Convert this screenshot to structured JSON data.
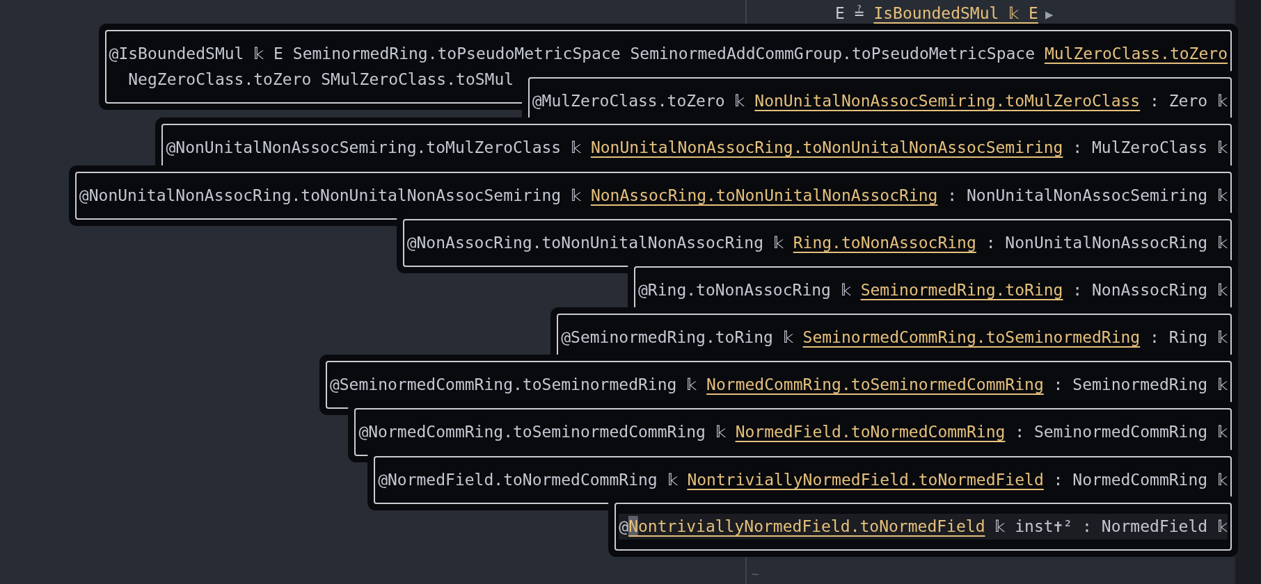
{
  "goal": {
    "before": "E ≟ ",
    "link": "IsBoundedSMul 𝕜 E",
    "toggle": "▶"
  },
  "popups": [
    {
      "lines": [
        [
          {
            "kind": "text",
            "text": "@IsBoundedSMul 𝕜 E SeminormedRing.toPseudoMetricSpace SeminormedAddCommGroup.toPseudoMetricSpace "
          },
          {
            "kind": "link",
            "text": "MulZeroClass.toZero"
          }
        ],
        [
          {
            "kind": "text",
            "text": "  NegZeroClass.toZero SMulZeroClass.toSMul"
          }
        ]
      ]
    },
    {
      "lines": [
        [
          {
            "kind": "text",
            "text": "@MulZeroClass.toZero 𝕜 "
          },
          {
            "kind": "link",
            "text": "NonUnitalNonAssocSemiring.toMulZeroClass"
          },
          {
            "kind": "text",
            "text": " : Zero 𝕜"
          }
        ]
      ]
    },
    {
      "lines": [
        [
          {
            "kind": "text",
            "text": "@NonUnitalNonAssocSemiring.toMulZeroClass 𝕜 "
          },
          {
            "kind": "link",
            "text": "NonUnitalNonAssocRing.toNonUnitalNonAssocSemiring"
          },
          {
            "kind": "text",
            "text": " : MulZeroClass 𝕜"
          }
        ]
      ]
    },
    {
      "lines": [
        [
          {
            "kind": "text",
            "text": "@NonUnitalNonAssocRing.toNonUnitalNonAssocSemiring 𝕜 "
          },
          {
            "kind": "link",
            "text": "NonAssocRing.toNonUnitalNonAssocRing"
          },
          {
            "kind": "text",
            "text": " : NonUnitalNonAssocSemiring 𝕜"
          }
        ]
      ]
    },
    {
      "lines": [
        [
          {
            "kind": "text",
            "text": "@NonAssocRing.toNonUnitalNonAssocRing 𝕜 "
          },
          {
            "kind": "link",
            "text": "Ring.toNonAssocRing"
          },
          {
            "kind": "text",
            "text": " : NonUnitalNonAssocRing 𝕜"
          }
        ]
      ]
    },
    {
      "lines": [
        [
          {
            "kind": "text",
            "text": "@Ring.toNonAssocRing 𝕜 "
          },
          {
            "kind": "link",
            "text": "SeminormedRing.toRing"
          },
          {
            "kind": "text",
            "text": " : NonAssocRing 𝕜"
          }
        ]
      ]
    },
    {
      "lines": [
        [
          {
            "kind": "text",
            "text": "@SeminormedRing.toRing 𝕜 "
          },
          {
            "kind": "link",
            "text": "SeminormedCommRing.toSeminormedRing"
          },
          {
            "kind": "text",
            "text": " : Ring 𝕜"
          }
        ]
      ]
    },
    {
      "lines": [
        [
          {
            "kind": "text",
            "text": "@SeminormedCommRing.toSeminormedRing 𝕜 "
          },
          {
            "kind": "link",
            "text": "NormedCommRing.toSeminormedCommRing"
          },
          {
            "kind": "text",
            "text": " : SeminormedRing 𝕜"
          }
        ]
      ]
    },
    {
      "lines": [
        [
          {
            "kind": "text",
            "text": "@NormedCommRing.toSeminormedCommRing 𝕜 "
          },
          {
            "kind": "link",
            "text": "NormedField.toNormedCommRing"
          },
          {
            "kind": "text",
            "text": " : SeminormedCommRing 𝕜"
          }
        ]
      ]
    },
    {
      "lines": [
        [
          {
            "kind": "text",
            "text": "@NormedField.toNormedCommRing 𝕜 "
          },
          {
            "kind": "link",
            "text": "NontriviallyNormedField.toNormedField"
          },
          {
            "kind": "text",
            "text": " : NormedCommRing 𝕜"
          }
        ]
      ]
    },
    {
      "highlighted": true,
      "lines": [
        [
          {
            "kind": "text",
            "text": "@"
          },
          {
            "kind": "link",
            "caret": true,
            "text": "NontriviallyNormedField.toNormedField"
          },
          {
            "kind": "text",
            "text": " 𝕜 inst✝² : NormedField 𝕜"
          }
        ]
      ]
    }
  ],
  "tilde": "~"
}
